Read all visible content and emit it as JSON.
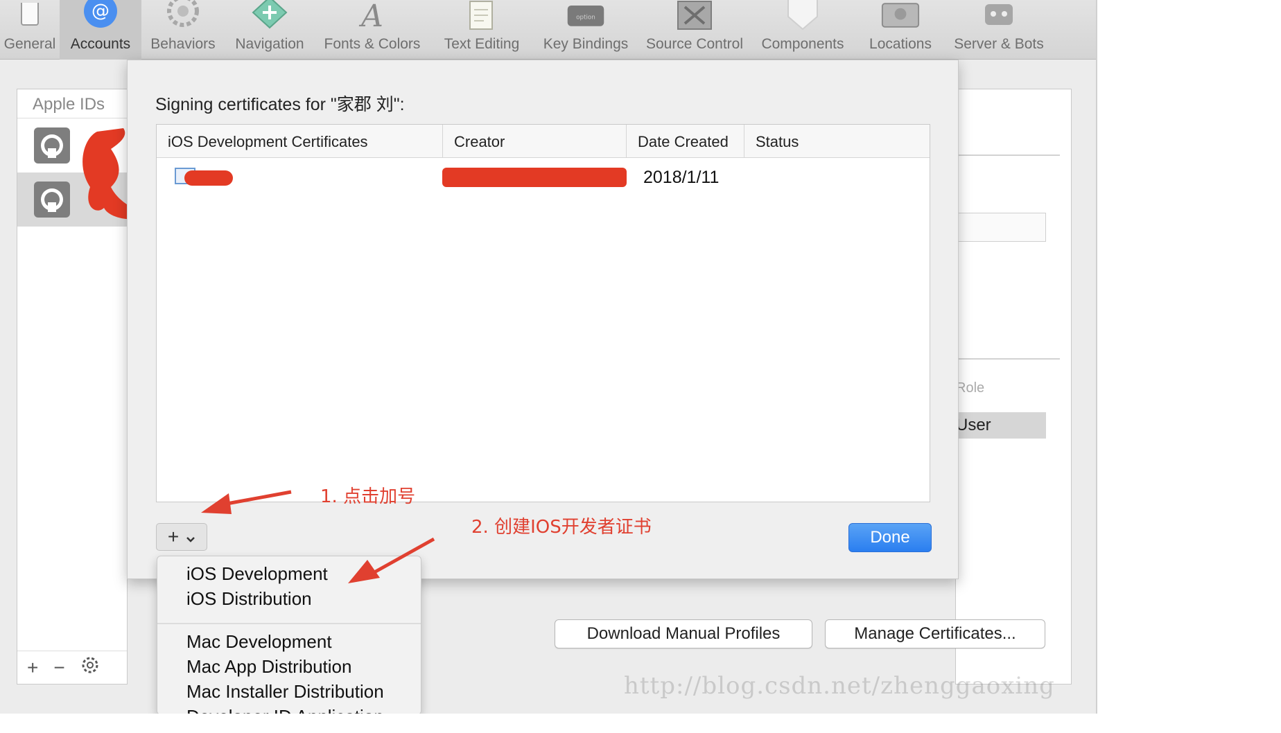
{
  "toolbar": {
    "items": [
      {
        "label": "General",
        "icon": "general-icon"
      },
      {
        "label": "Accounts",
        "icon": "at-sign-icon",
        "active": true
      },
      {
        "label": "Behaviors",
        "icon": "gears-icon"
      },
      {
        "label": "Navigation",
        "icon": "navigation-icon"
      },
      {
        "label": "Fonts & Colors",
        "icon": "font-icon"
      },
      {
        "label": "Text Editing",
        "icon": "text-edit-icon"
      },
      {
        "label": "Key Bindings",
        "icon": "option-key-icon"
      },
      {
        "label": "Source Control",
        "icon": "source-control-icon"
      },
      {
        "label": "Components",
        "icon": "shield-icon"
      },
      {
        "label": "Locations",
        "icon": "drive-icon"
      },
      {
        "label": "Server & Bots",
        "icon": "server-icon"
      }
    ]
  },
  "accounts_panel": {
    "header": "Apple IDs",
    "role_label": "Role",
    "role_value": "User",
    "download_button": "Download Manual Profiles",
    "manage_button": "Manage Certificates..."
  },
  "sheet": {
    "title": "Signing certificates for \"家郡 刘\":",
    "columns": [
      "iOS Development Certificates",
      "Creator",
      "Date Created",
      "Status"
    ],
    "rows": [
      {
        "date_created": "2018/1/11"
      }
    ],
    "done_label": "Done"
  },
  "menu": {
    "items": [
      "iOS Development",
      "iOS Distribution",
      "Mac Development",
      "Mac App Distribution",
      "Mac Installer Distribution",
      "Developer ID Application"
    ]
  },
  "annotations": {
    "step1": "1. 点击加号",
    "step2": "2. 创建IOS开发者证书"
  },
  "watermark": "http://blog.csdn.net/zhenggaoxing",
  "colors": {
    "annotation": "#e04030",
    "primary_button": "#2a7ef0"
  }
}
